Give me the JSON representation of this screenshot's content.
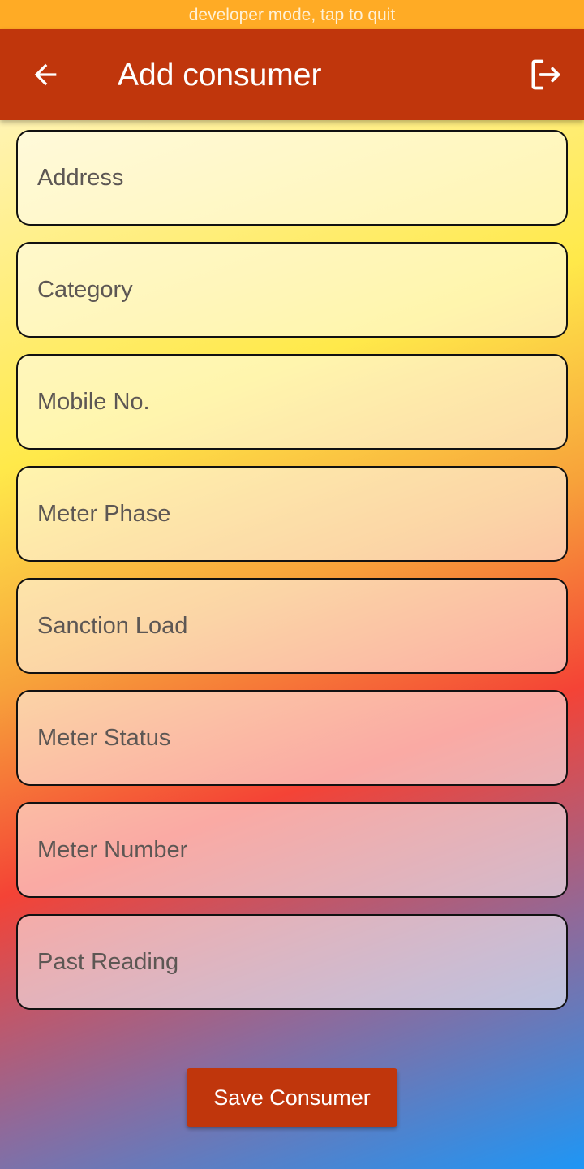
{
  "banner": {
    "text": "developer mode, tap to quit"
  },
  "app_bar": {
    "title": "Add consumer",
    "back_icon": "arrow-left-icon",
    "logout_icon": "logout-icon",
    "color": "#c0360c"
  },
  "form": {
    "fields": [
      {
        "placeholder": "Address",
        "value": ""
      },
      {
        "placeholder": "Category",
        "value": ""
      },
      {
        "placeholder": "Mobile No.",
        "value": ""
      },
      {
        "placeholder": "Meter Phase",
        "value": ""
      },
      {
        "placeholder": "Sanction Load",
        "value": ""
      },
      {
        "placeholder": "Meter Status",
        "value": ""
      },
      {
        "placeholder": "Meter Number",
        "value": ""
      },
      {
        "placeholder": "Past Reading",
        "value": ""
      }
    ]
  },
  "actions": {
    "save_label": "Save Consumer"
  },
  "colors": {
    "banner": "#ffab25",
    "accent": "#c0360c"
  }
}
